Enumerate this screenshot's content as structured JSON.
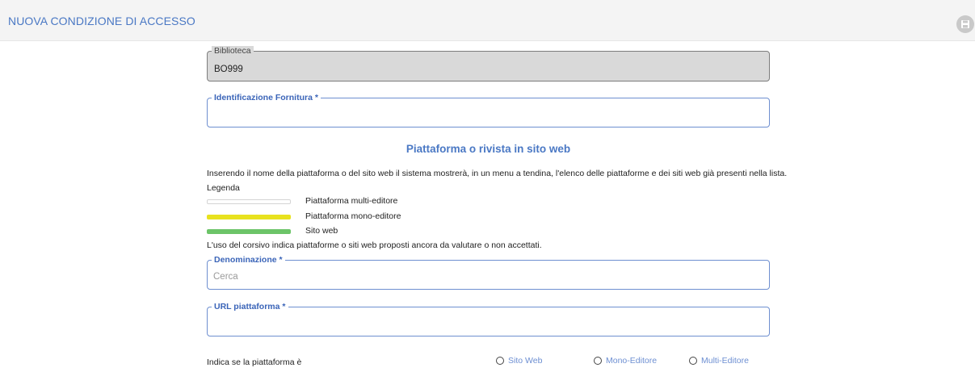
{
  "header": {
    "title": "NUOVA CONDIZIONE DI ACCESSO",
    "save_icon": "save-icon"
  },
  "biblioteca": {
    "label": "Biblioteca",
    "value": "BO999"
  },
  "identificazione": {
    "label": "Identificazione Fornitura *",
    "value": ""
  },
  "section": {
    "heading": "Piattaforma o rivista in sito web",
    "description": "Inserendo il nome della piattaforma o del sito web il sistema mostrerà, in un menu a tendina, l'elenco delle piattaforme e dei siti web già presenti nella lista.",
    "legend_title": "Legenda",
    "legend": [
      {
        "label": "Piattaforma multi-editore",
        "color": "#ffffff"
      },
      {
        "label": "Piattaforma mono-editore",
        "color": "#e8e21e"
      },
      {
        "label": "Sito web",
        "color": "#6cc468"
      }
    ],
    "note": "L'uso del corsivo indica piattaforme o siti web proposti ancora da valutare o non accettati."
  },
  "denominazione": {
    "label": "Denominazione *",
    "placeholder": "Cerca",
    "value": ""
  },
  "url": {
    "label": "URL piattaforma *",
    "value": ""
  },
  "tipo": {
    "label": "Indica se la piattaforma è",
    "options": [
      "Sito Web",
      "Mono-Editore",
      "Multi-Editore"
    ]
  },
  "colors": {
    "accent": "#4a78c4",
    "field_border": "#6e8fd0",
    "readonly_bg": "#d9d9d9"
  }
}
